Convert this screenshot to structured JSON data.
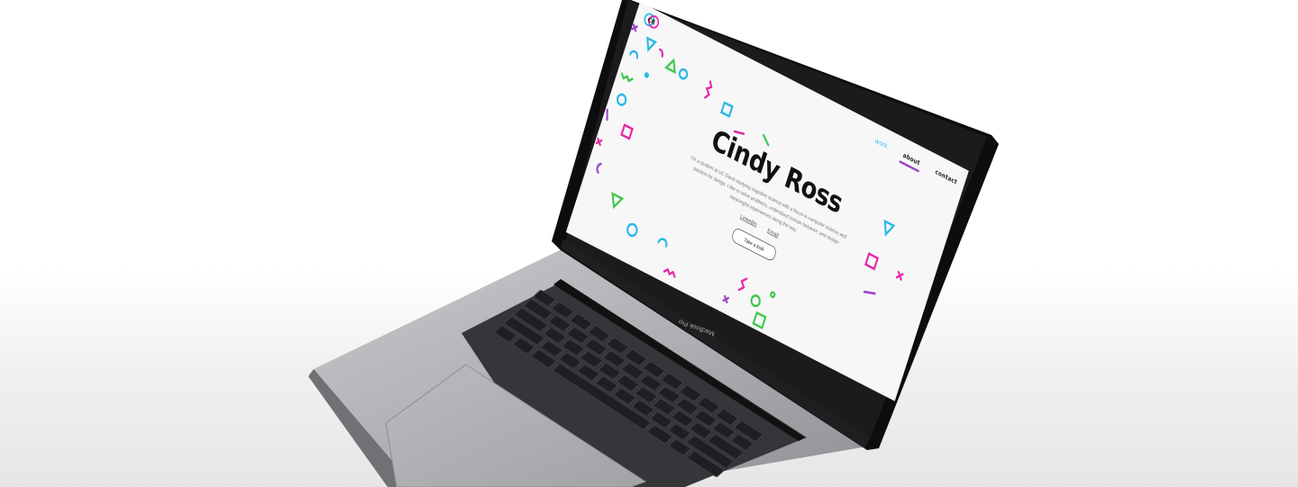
{
  "website": {
    "logo_text": "CR",
    "nav": [
      {
        "label": "work",
        "active": true
      },
      {
        "label": "about",
        "active": false
      },
      {
        "label": "contact",
        "active": false
      }
    ],
    "hero_title": "Cindy Ross",
    "hero_paragraph": "I'm a student at UC Davis studying cognitive science with a focus in computer science and passion for design. I like to solve problems, understand human behavior, and design meaningful experiences along the way.",
    "links": {
      "linkedin": "LinkedIn",
      "separator": "·",
      "email": "Email"
    },
    "cta_label": "Take a look"
  },
  "laptop": {
    "brand_label": "MacBook Pro"
  },
  "colors": {
    "cyan": "#2bb8e6",
    "magenta": "#e62aa6",
    "green": "#3fc94a",
    "purple": "#9b44c9",
    "lid_bezel": "#111111",
    "body_silver": "#a9abae",
    "keyboard_key": "#2b2c2f"
  }
}
